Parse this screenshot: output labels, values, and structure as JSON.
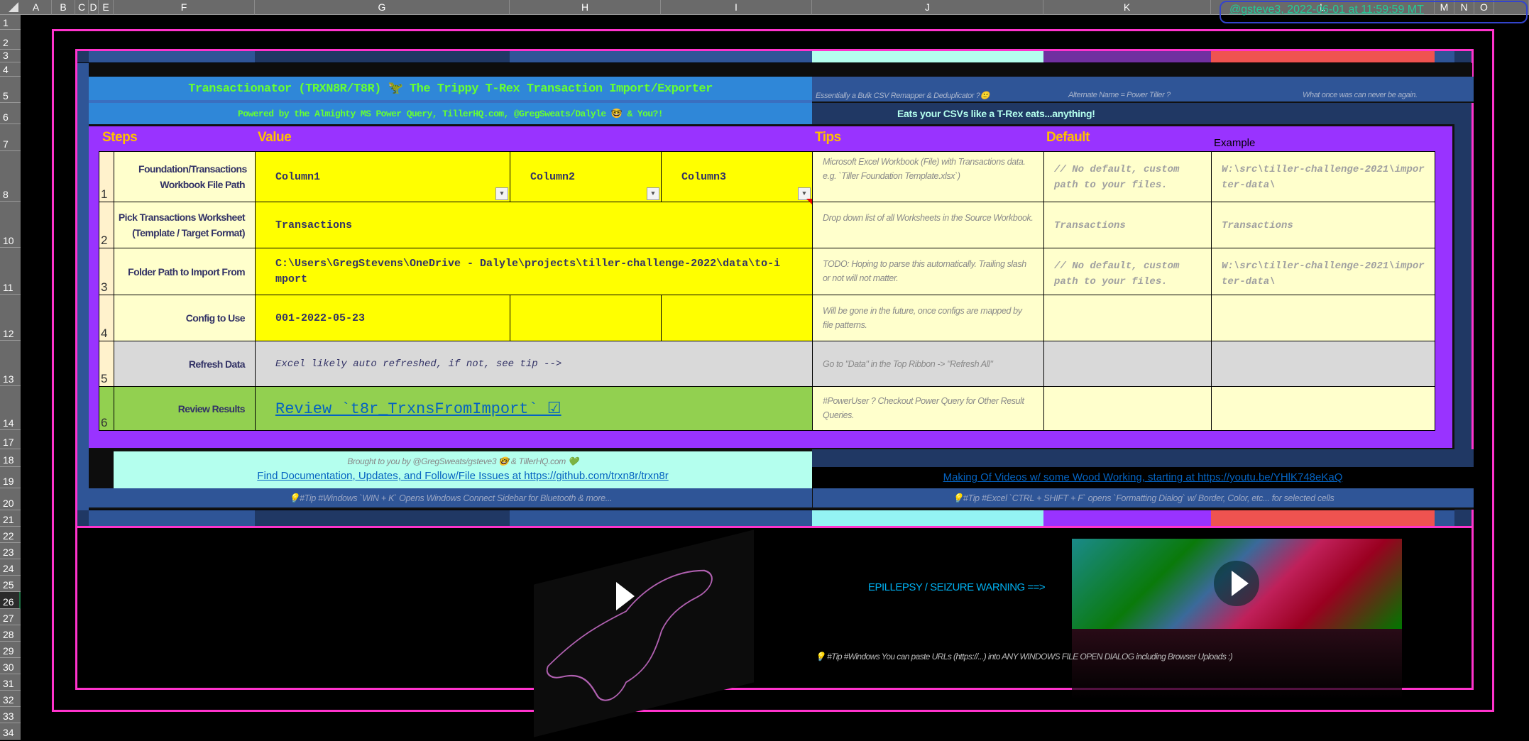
{
  "grid": {
    "columns": [
      "A",
      "B",
      "C",
      "D",
      "E",
      "F",
      "G",
      "H",
      "I",
      "J",
      "K",
      "L",
      "M",
      "N",
      "O"
    ],
    "rows": [
      "1",
      "2",
      "3",
      "4",
      "5",
      "6",
      "7",
      "8",
      "10",
      "11",
      "12",
      "13",
      "14",
      "17",
      "18",
      "19",
      "20",
      "21",
      "22",
      "23",
      "24",
      "25",
      "26",
      "27",
      "28",
      "29",
      "30",
      "31",
      "32",
      "33",
      "34"
    ],
    "selected_row": "26"
  },
  "timestamp": "@gsteve3, 2022-06-01 at 11:59:59 MT",
  "header": {
    "title": "Transactionator (TRXN8R/T8R) 🦖 The Trippy T-Rex Transaction Import/Exporter",
    "subtitle": "Powered by the Almighty MS Power Query, TillerHQ.com, @GregSweats/Dalyle 🤓 & You?!",
    "tagline_1": "Essentially a Bulk CSV Remapper & Deduplicator ?🙂",
    "tagline_2": "Alternate Name = Power Tiller ?",
    "tagline_3": "What once was can never be again.",
    "slogan": "Eats your CSVs like a T-Rex eats...anything!"
  },
  "table": {
    "headers": {
      "steps": "Steps",
      "value": "Value",
      "tips": "Tips",
      "default": "Default",
      "example": "Example"
    },
    "rows": [
      {
        "num": "1",
        "label": "Foundation/Transactions Workbook File Path",
        "values": [
          "Column1",
          "Column2",
          "Column3"
        ],
        "tip": "Microsoft Excel Workbook (File) with Transactions data.\ne.g. `Tiller Foundation Template.xlsx`)",
        "default": "// No default, custom path to your files.",
        "example": "W:\\src\\tiller-challenge-2021\\importer-data\\"
      },
      {
        "num": "2",
        "label": "Pick Transactions Worksheet (Template / Target Format)",
        "value": "Transactions",
        "tip": "Drop down list of all Worksheets in the Source Workbook.",
        "default": "Transactions",
        "example": "Transactions"
      },
      {
        "num": "3",
        "label": "Folder Path to Import From",
        "value": "C:\\Users\\GregStevens\\OneDrive - Dalyle\\projects\\tiller-challenge-2022\\data\\to-import",
        "tip": "TODO: Hoping to parse this automatically. Trailing slash or not will not matter.",
        "default": "// No default, custom path to your files.",
        "example": "W:\\src\\tiller-challenge-2021\\importer-data\\"
      },
      {
        "num": "4",
        "label": "Config to Use",
        "value": "001-2022-05-23",
        "tip": "Will be gone in the future, once configs are mapped by file patterns."
      },
      {
        "num": "5",
        "label": "Refresh Data",
        "value": "Excel likely auto refreshed, if not, see tip -->",
        "tip": "Go to \"Data\" in the Top Ribbon -> \"Refresh All\""
      },
      {
        "num": "6",
        "label": "Review Results",
        "value": "Review `t8r_TrxnsFromImport` ☑",
        "tip": "#PowerUser ? Checkout Power Query for Other Result Queries."
      }
    ]
  },
  "footer": {
    "credit": "Brought to you by @GregSweats/gsteve3 🤓 & TillerHQ.com 💚",
    "docs_link": "Find Documentation, Updates, and Follow/File Issues at https://github.com/trxn8r/trxn8r",
    "videos_link": "Making Of Videos w/ some Wood Working, starting at https://youtu.be/YHlK748eKaQ",
    "tip_windows": "💡#Tip #Windows `WIN + K` Opens Windows Connect Sidebar for Bluetooth & more...",
    "tip_excel": "💡#Tip #Excel `CTRL + SHIFT + F` opens `Formatting Dialog` w/ Border, Color, etc... for selected cells",
    "warning": "EPILLEPSY / SEIZURE WARNING ==>",
    "tip_urls": "💡 #Tip #Windows You can paste URLs (https://...) into ANY WINDOWS FILE OPEN DIALOG including Browser Uploads :)"
  },
  "colors": {
    "purple": "#9933FF",
    "yellow": "#FFFF00",
    "cream": "#FFFFCC",
    "green": "#92D050",
    "gray": "#D9D9D9",
    "mint": "#B4FFEE",
    "navy": "#203864",
    "blue": "#2F5597",
    "banner": "#2F87D8",
    "pink": "#FF33CC",
    "coral": "#EF5350",
    "heading": "#FFC000"
  }
}
